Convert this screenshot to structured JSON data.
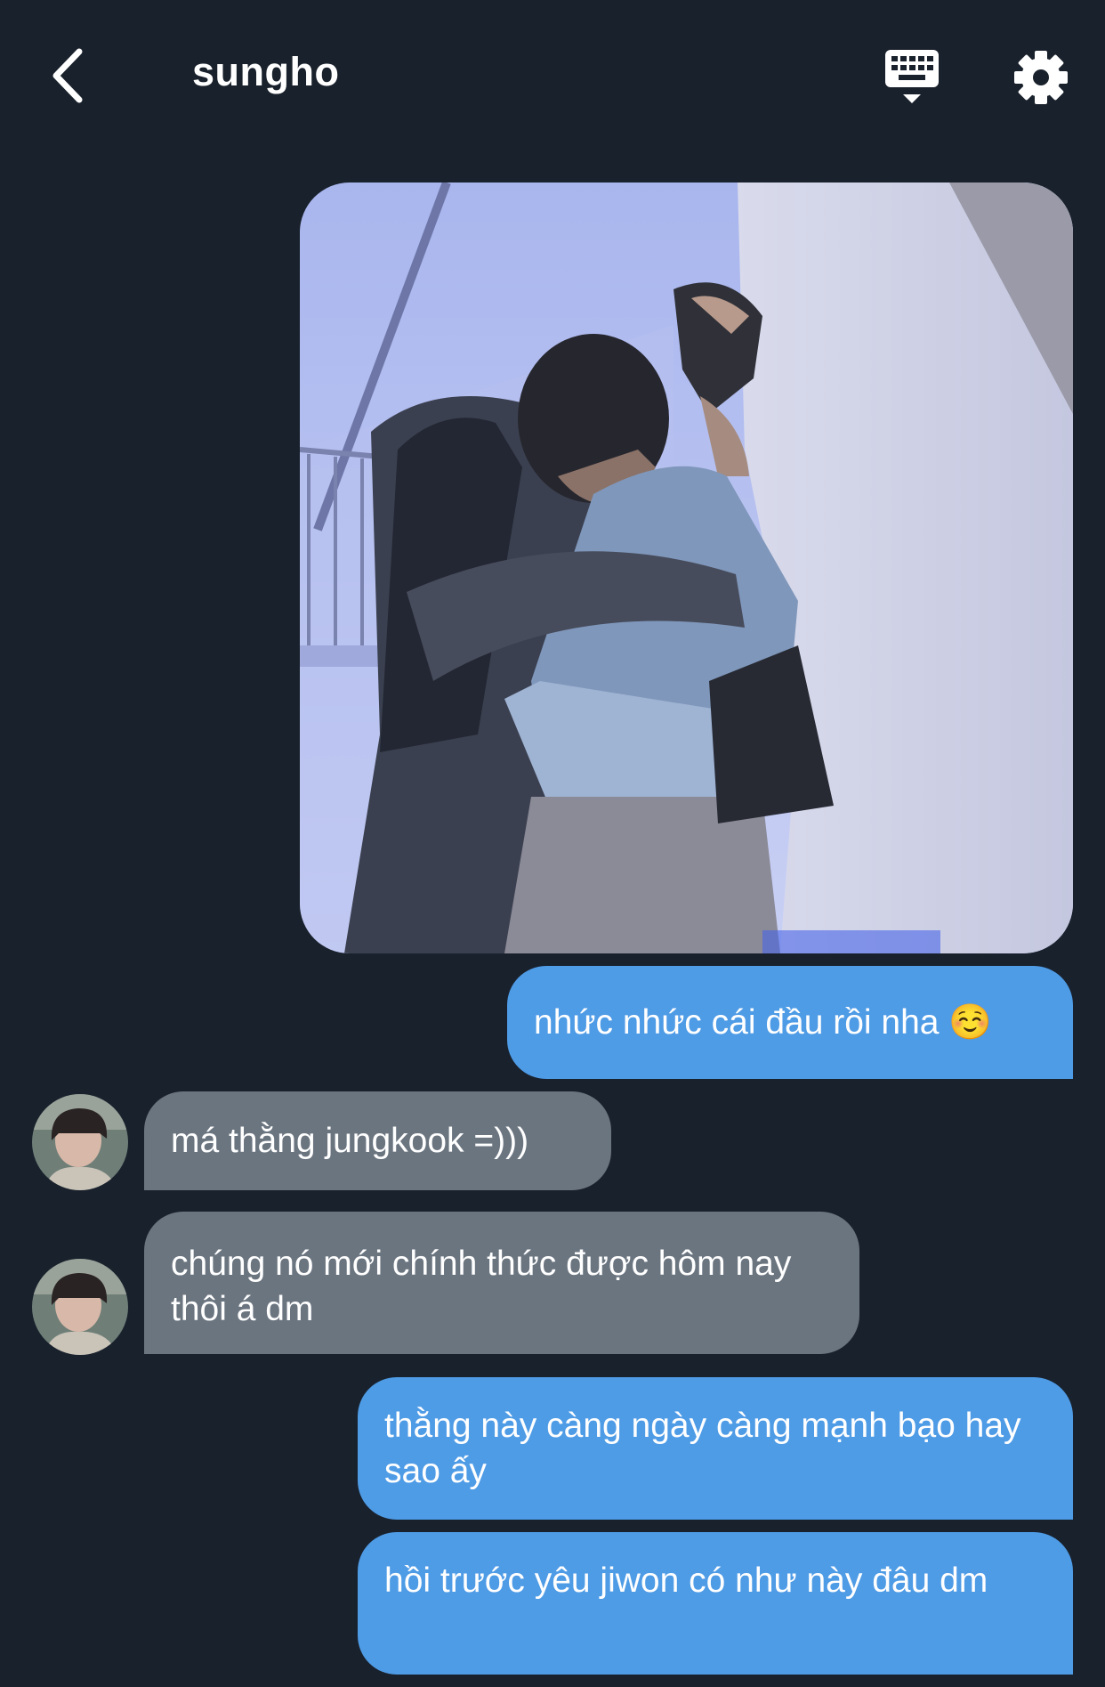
{
  "header": {
    "title": "sungho",
    "back_icon": "chevron-left-icon",
    "keyboard_icon": "keyboard-icon",
    "settings_icon": "gear-icon"
  },
  "messages": [
    {
      "side": "out",
      "type": "image",
      "alt": ""
    },
    {
      "side": "out",
      "text": "nhức nhức cái đầu rồi nha ☺️"
    },
    {
      "side": "in",
      "text": "má thằng jungkook =)))"
    },
    {
      "side": "in",
      "text": "chúng nó mới chính thức được hôm nay thôi á dm"
    },
    {
      "side": "out",
      "text": "thằng này càng ngày càng mạnh bạo hay sao ấy"
    },
    {
      "side": "out",
      "text": "hồi trước yêu jiwon có như này đâu dm"
    }
  ],
  "colors": {
    "background": "#19212c",
    "outgoing_bubble": "#4e9be6",
    "incoming_bubble": "#6b7580"
  }
}
